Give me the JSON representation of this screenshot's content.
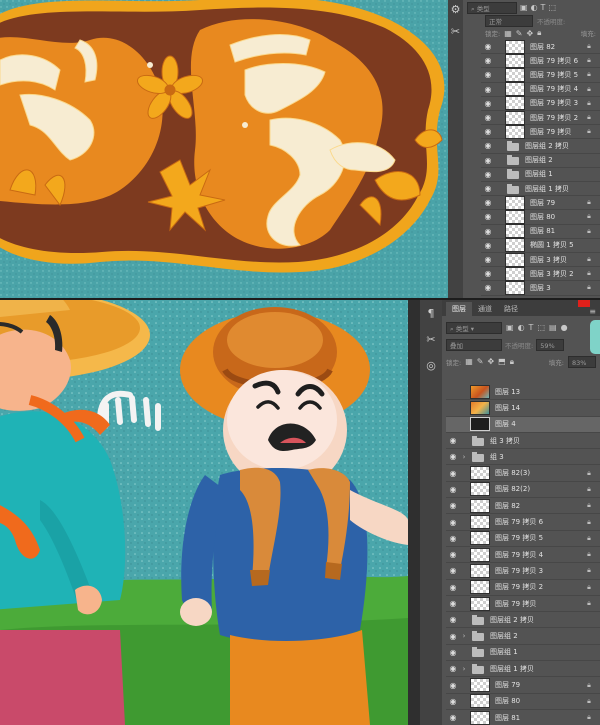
{
  "top_panel": {
    "search_label": "类型",
    "blend_label": "正常",
    "opacity_label": "不透明度:",
    "lock_label": "锁定:",
    "fill_label": "填充:",
    "layers": [
      {
        "name": "图层 82",
        "type": "layer",
        "lock": true
      },
      {
        "name": "图层 79 拷贝 6",
        "type": "layer",
        "lock": true
      },
      {
        "name": "图层 79 拷贝 5",
        "type": "layer",
        "lock": true
      },
      {
        "name": "图层 79 拷贝 4",
        "type": "layer",
        "lock": true
      },
      {
        "name": "图层 79 拷贝 3",
        "type": "layer",
        "lock": true
      },
      {
        "name": "图层 79 拷贝 2",
        "type": "layer",
        "lock": true
      },
      {
        "name": "图层 79 拷贝",
        "type": "layer",
        "lock": true
      },
      {
        "name": "图层组 2 拷贝",
        "type": "folder",
        "lock": false
      },
      {
        "name": "图层组 2",
        "type": "folder",
        "lock": false
      },
      {
        "name": "图层组 1",
        "type": "folder",
        "lock": false
      },
      {
        "name": "图层组 1 拷贝",
        "type": "folder",
        "lock": false
      },
      {
        "name": "图层 79",
        "type": "layer",
        "lock": true
      },
      {
        "name": "图层 80",
        "type": "layer",
        "lock": true
      },
      {
        "name": "图层 81",
        "type": "layer",
        "lock": true
      },
      {
        "name": "椭圆 1 拷贝 5",
        "type": "layer",
        "lock": false
      },
      {
        "name": "图层 3 拷贝",
        "type": "layer",
        "lock": true
      },
      {
        "name": "图层 3 拷贝 2",
        "type": "layer",
        "lock": true
      },
      {
        "name": "图层 3",
        "type": "layer",
        "lock": true
      }
    ]
  },
  "bottom_panel": {
    "tabs": [
      "图层",
      "通道",
      "路径"
    ],
    "search_label": "类型",
    "blend_label": "叠加",
    "opacity_label": "不透明度:",
    "opacity_value": "59%",
    "lock_label": "锁定:",
    "fill_label": "填充:",
    "fill_value": "83%",
    "layers": [
      {
        "name": "图层 13",
        "type": "art1",
        "eye": false,
        "lock": false,
        "fold": false
      },
      {
        "name": "图层 14",
        "type": "art2",
        "eye": false,
        "lock": false,
        "fold": false
      },
      {
        "name": "图层 4",
        "type": "dark",
        "eye": false,
        "lock": false,
        "fold": false,
        "selected": true
      },
      {
        "name": "组 3 拷贝",
        "type": "folder",
        "eye": true,
        "lock": false,
        "fold": false
      },
      {
        "name": "组 3",
        "type": "folder",
        "eye": true,
        "lock": false,
        "fold": true
      },
      {
        "name": "图层 82(3)",
        "type": "layer",
        "eye": true,
        "lock": true,
        "fold": false
      },
      {
        "name": "图层 82(2)",
        "type": "layer",
        "eye": true,
        "lock": true,
        "fold": false
      },
      {
        "name": "图层 82",
        "type": "layer",
        "eye": true,
        "lock": true,
        "fold": false
      },
      {
        "name": "图层 79 拷贝 6",
        "type": "layer",
        "eye": true,
        "lock": true,
        "fold": false
      },
      {
        "name": "图层 79 拷贝 5",
        "type": "layer",
        "eye": true,
        "lock": true,
        "fold": false
      },
      {
        "name": "图层 79 拷贝 4",
        "type": "layer",
        "eye": true,
        "lock": true,
        "fold": false
      },
      {
        "name": "图层 79 拷贝 3",
        "type": "layer",
        "eye": true,
        "lock": true,
        "fold": false
      },
      {
        "name": "图层 79 拷贝 2",
        "type": "layer",
        "eye": true,
        "lock": true,
        "fold": false
      },
      {
        "name": "图层 79 拷贝",
        "type": "layer",
        "eye": true,
        "lock": true,
        "fold": false
      },
      {
        "name": "图层组 2 拷贝",
        "type": "folder",
        "eye": true,
        "lock": false,
        "fold": false
      },
      {
        "name": "图层组 2",
        "type": "folder",
        "eye": true,
        "lock": false,
        "fold": true
      },
      {
        "name": "图层组 1",
        "type": "folder",
        "eye": true,
        "lock": false,
        "fold": false
      },
      {
        "name": "图层组 1 拷贝",
        "type": "folder",
        "eye": true,
        "lock": false,
        "fold": true
      },
      {
        "name": "图层 79",
        "type": "layer",
        "eye": true,
        "lock": true,
        "fold": false
      },
      {
        "name": "图层 80",
        "type": "layer",
        "eye": true,
        "lock": true,
        "fold": false
      },
      {
        "name": "图层 81",
        "type": "layer",
        "eye": true,
        "lock": true,
        "fold": false
      }
    ]
  },
  "colors": {
    "panel_bg": "#535353",
    "canvas_teal": "#4aa3a8",
    "title_orange": "#e8891f",
    "title_cream": "#f6e7c6",
    "title_brown": "#7d3a1f",
    "grass_green": "#4cab3a"
  }
}
